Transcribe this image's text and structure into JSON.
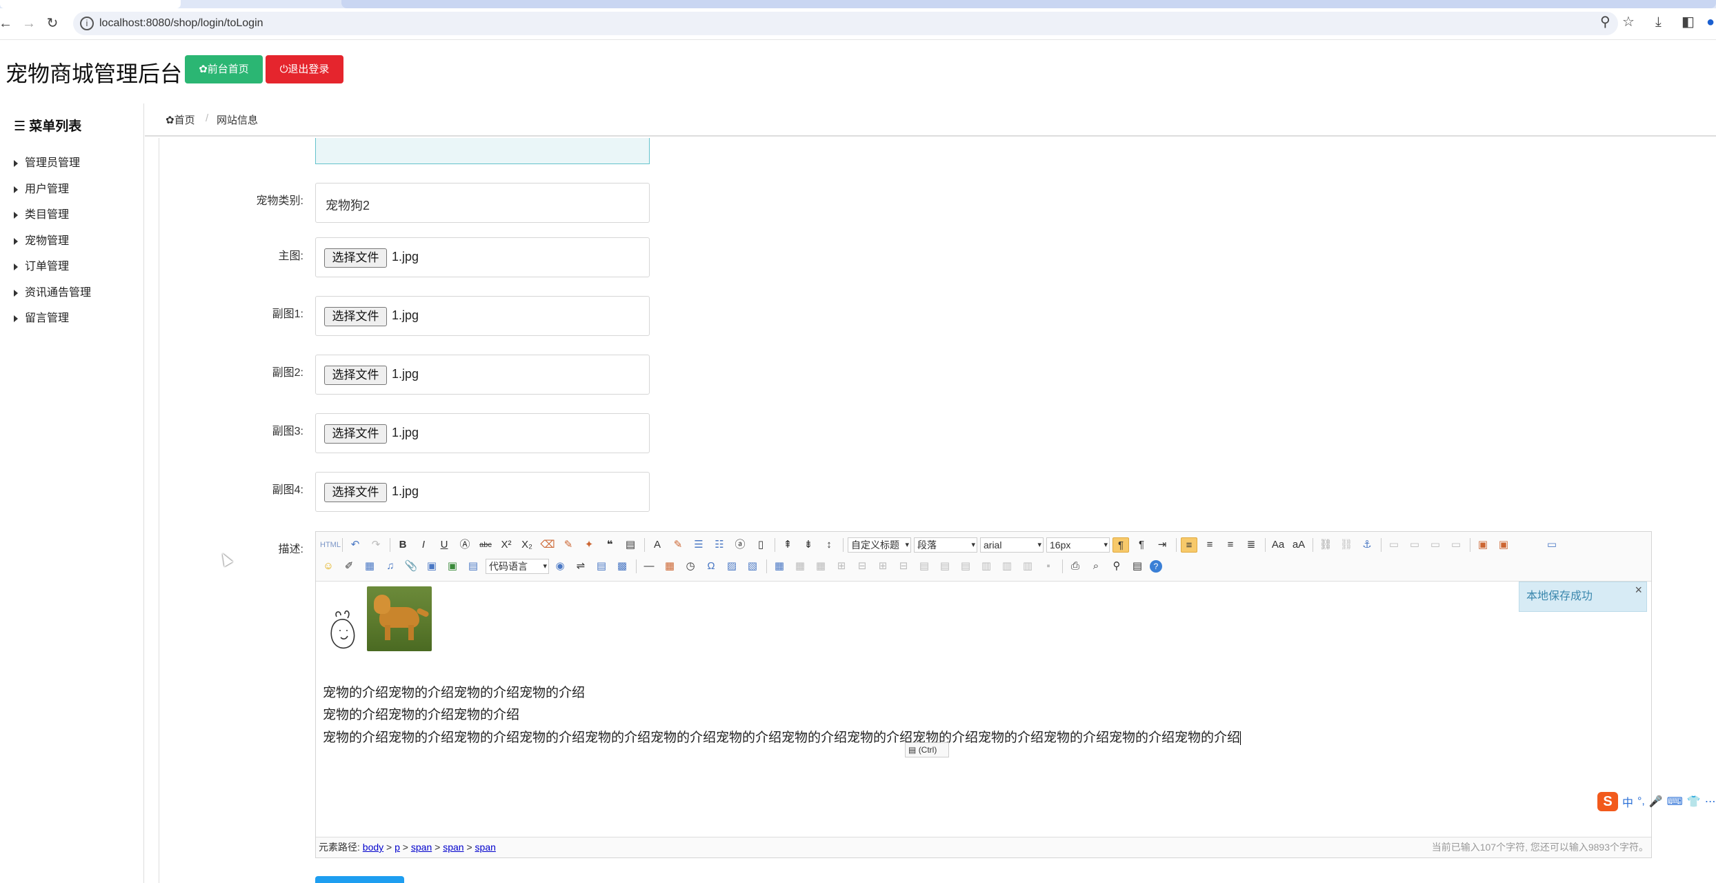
{
  "browser": {
    "url": "localhost:8080/shop/login/toLogin",
    "back_icon": "←",
    "forward_icon": "→",
    "reload_icon": "↻",
    "info_icon": "i",
    "zoom_icon": "⚲",
    "star_icon": "☆",
    "download_icon": "⤓",
    "sidepanel_icon": "◧",
    "profile_icon": "●"
  },
  "header": {
    "title": "宠物商城管理后台",
    "home_button": "✿前台首页",
    "logout_button": "⏻退出登录",
    "home_color": "#2bb673",
    "logout_color": "#e5252d"
  },
  "sidebar": {
    "title": "☰ 菜单列表",
    "items": [
      {
        "label": "管理员管理"
      },
      {
        "label": "用户管理"
      },
      {
        "label": "类目管理"
      },
      {
        "label": "宠物管理"
      },
      {
        "label": "订单管理"
      },
      {
        "label": "资讯通告管理"
      },
      {
        "label": "留言管理"
      }
    ]
  },
  "breadcrumb": {
    "home": "✿首页",
    "separator": "/",
    "current": "网站信息"
  },
  "form": {
    "category_label": "宠物类别:",
    "category_value": "宠物狗2",
    "main_image_label": "主图:",
    "sub1_label": "副图1:",
    "sub2_label": "副图2:",
    "sub3_label": "副图3:",
    "sub4_label": "副图4:",
    "file_button": "选择文件",
    "file_name": "1.jpg",
    "description_label": "描述:"
  },
  "editor": {
    "toolbar": {
      "custom_title": "自定义标题",
      "paragraph": "段落",
      "font_family": "arial",
      "font_size": "16px",
      "code_language": "代码语言"
    },
    "content_lines": [
      "宠物的介绍宠物的介绍宠物的介绍宠物的介绍",
      "宠物的介绍宠物的介绍宠物的介绍",
      "宠物的介绍宠物的介绍宠物的介绍宠物的介绍宠物的介绍宠物的介绍宠物的介绍宠物的介绍宠物的介绍宠物的介绍宠物的介绍宠物的介绍宠物的介绍宠物的介绍"
    ],
    "paste_tip": "(Ctrl)",
    "toast": "本地保存成功",
    "toast_close": "×",
    "status_path_label": "元素路径:",
    "status_path": [
      "body",
      "p",
      "span",
      "span",
      "span"
    ],
    "status_count": "当前已输入107个字符, 您还可以输入9893个字符。"
  },
  "ime": {
    "logo": "S",
    "chinese": "中",
    "punct": "°,",
    "mic": "🎤",
    "keyboard": "⌨",
    "skin": "👕",
    "more": "⋯"
  }
}
